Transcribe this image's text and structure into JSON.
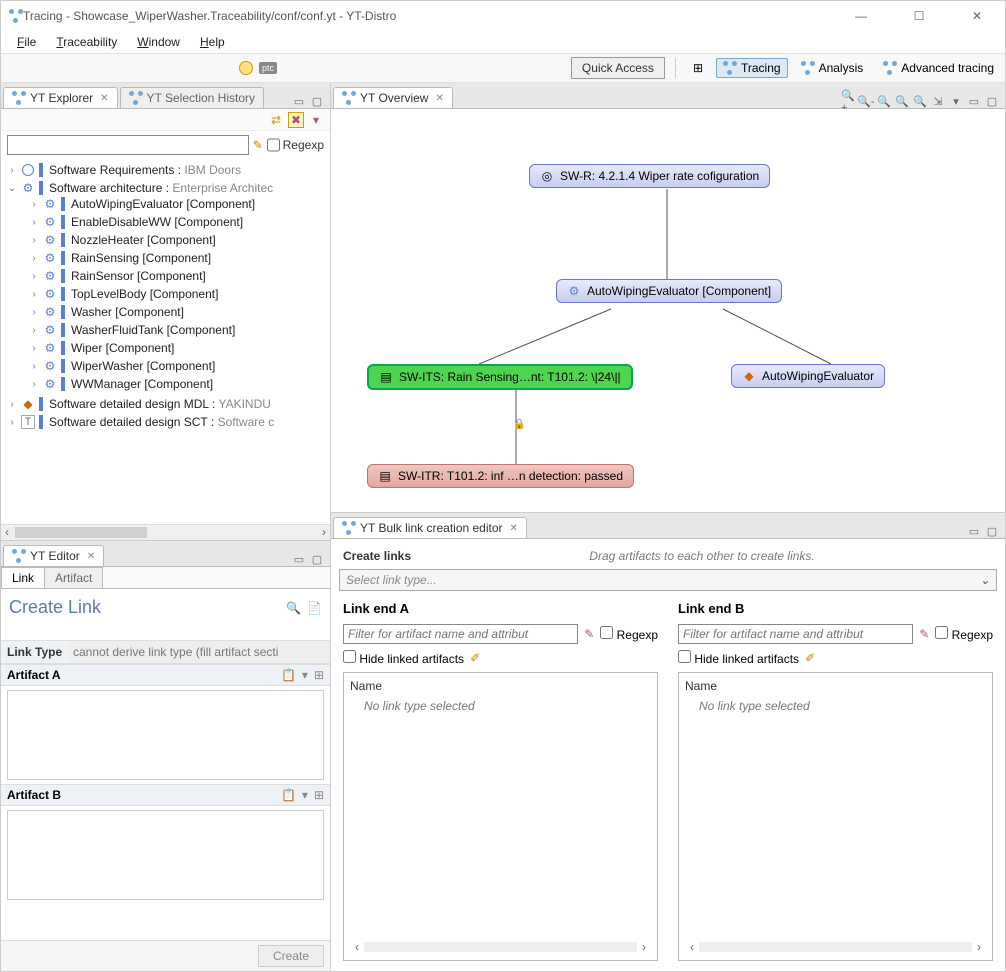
{
  "window": {
    "title": "Tracing - Showcase_WiperWasher.Traceability/conf/conf.yt - YT-Distro"
  },
  "menu": {
    "file": "File",
    "traceability": "Traceability",
    "window": "Window",
    "help": "Help"
  },
  "toolbar": {
    "quick_access": "Quick Access",
    "ptc_badge": "ptc",
    "perspectives": {
      "tracing": "Tracing",
      "analysis": "Analysis",
      "advanced": "Advanced tracing"
    }
  },
  "views": {
    "explorer_tab": "YT Explorer",
    "selection_history_tab": "YT Selection History",
    "overview_tab": "YT Overview",
    "editor_tab": "YT Editor",
    "bulk_tab": "YT Bulk link creation editor"
  },
  "explorer": {
    "regexp_label": "Regexp",
    "roots": [
      {
        "label": "Software Requirements",
        "provider": "IBM Doors"
      },
      {
        "label": "Software architecture",
        "provider": "Enterprise Architec"
      }
    ],
    "arch_children": [
      "AutoWipingEvaluator [Component]",
      "EnableDisableWW [Component]",
      "NozzleHeater [Component]",
      "RainSensing [Component]",
      "RainSensor [Component]",
      "TopLevelBody [Component]",
      "Washer [Component]",
      "WasherFluidTank [Component]",
      "Wiper [Component]",
      "WiperWasher [Component]",
      "WWManager [Component]"
    ],
    "mdl": {
      "label": "Software detailed design MDL",
      "provider": "YAKINDU"
    },
    "sct": {
      "label": "Software detailed design SCT",
      "provider": "Software c"
    }
  },
  "overview": {
    "n1": "SW-R: 4.2.1.4 Wiper rate cofiguration",
    "n2": "AutoWipingEvaluator [Component]",
    "n3": "SW-ITS: Rain Sensing…nt: T101.2: \\|24\\||",
    "n4": "AutoWipingEvaluator",
    "n5": "SW-ITR: T101.2: inf …n detection: passed"
  },
  "editor": {
    "tab_link": "Link",
    "tab_artifact": "Artifact",
    "heading": "Create Link",
    "linktype_label": "Link Type",
    "linktype_value": "cannot derive link type (fill artifact secti",
    "artA": "Artifact A",
    "artB": "Artifact B",
    "create_btn": "Create"
  },
  "bulk": {
    "heading": "Create links",
    "hint": "Drag artifacts to each other to create links.",
    "select_placeholder": "Select link type...",
    "endA": "Link end A",
    "endB": "Link end B",
    "filter_placeholder": "Filter for artifact name and attribut",
    "regexp": "Regexp",
    "hide_linked": "Hide linked artifacts",
    "name_col": "Name",
    "no_type_msg": "No link type selected"
  }
}
